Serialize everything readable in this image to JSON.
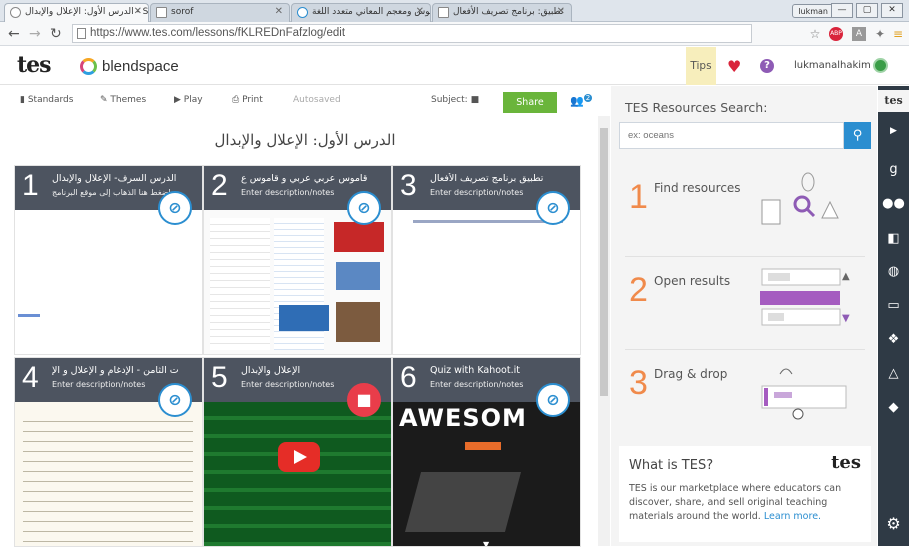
{
  "browser": {
    "tabs": [
      {
        "label": "الدرس الأول: الإعلال والإبدال - S",
        "active": true
      },
      {
        "label": "sorof",
        "active": false
      },
      {
        "label": "قاموس ومعجم المعاني متعدد اللغة",
        "active": false
      },
      {
        "label": "تطبيق: برنامج تصريف الأفعال",
        "active": false
      }
    ],
    "user_pill": "lukman",
    "url": "https://www.tes.com/lessons/fKLREDnFafzlog/edit",
    "window_buttons": [
      "—",
      "▢",
      "✕"
    ]
  },
  "app": {
    "tes_logo": "tes",
    "brand": "blendspace",
    "tips": "Tips",
    "username": "lukmanalhakim"
  },
  "toolbar": {
    "standards": "Standards",
    "themes": "Themes",
    "play": "Play",
    "print": "Print",
    "autosaved": "Autosaved",
    "subject": "Subject:",
    "share": "Share",
    "collab_count": "2"
  },
  "lesson": {
    "title": "الدرس الأول: الإعلال والإبدال",
    "tiles": [
      {
        "num": "1",
        "title": "الدرس السرف- الإعلال والإبدال",
        "desc": "اضغط هنا الذهاب إلى موقع البرنامج",
        "type": "link",
        "thumb": "doc"
      },
      {
        "num": "2",
        "title": "قاموس عربي عربي و قاموس ع",
        "desc": "Enter description/notes",
        "type": "link",
        "thumb": "site"
      },
      {
        "num": "3",
        "title": "تطبيق برنامج تصريف الأفعال",
        "desc": "Enter description/notes",
        "type": "link",
        "thumb": "doc"
      },
      {
        "num": "4",
        "title": "ت الثامن - الإدغام و الإعلال و الإ",
        "desc": "Enter description/notes",
        "type": "link",
        "thumb": "doc"
      },
      {
        "num": "5",
        "title": "الإعلال والإبدال",
        "desc": "Enter description/notes",
        "type": "video",
        "thumb": "video"
      },
      {
        "num": "6",
        "title": "Quiz with Kahoot.it",
        "desc": "Enter description/notes",
        "type": "link",
        "thumb": "kahoot",
        "thumb_text": "AWESOM"
      }
    ]
  },
  "resources": {
    "title": "TES Resources Search:",
    "placeholder": "ex: oceans",
    "steps": [
      {
        "num": "1",
        "label": "Find resources"
      },
      {
        "num": "2",
        "label": "Open results"
      },
      {
        "num": "3",
        "label": "Drag & drop"
      }
    ],
    "what_title": "What is TES?",
    "what_body": "TES is our marketplace where educators can discover, share, and sell original teaching materials around the world. ",
    "learn_more": "Learn more.",
    "tes_mini": "tes"
  },
  "sidebar": {
    "tes_label": "tes",
    "icons": [
      "youtube-icon",
      "google-icon",
      "flickr-icon",
      "book-icon",
      "globe-icon",
      "monitor-icon",
      "dropbox-icon",
      "drive-icon",
      "tag-icon",
      "gear-icon"
    ]
  },
  "colors": {
    "accent": "#2b8ed0",
    "share_green": "#6ab53b",
    "step_orange": "#f08a4b",
    "sidebar_dark": "#2f3a45",
    "tile_band": "#343c4a"
  }
}
